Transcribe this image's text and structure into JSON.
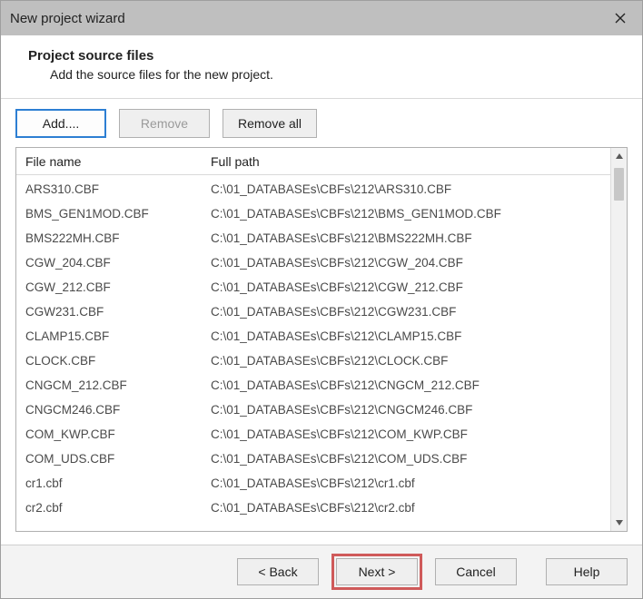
{
  "titlebar": {
    "title": "New project wizard"
  },
  "header": {
    "title": "Project source files",
    "subtitle": "Add the source files for the new project."
  },
  "toolbar": {
    "add_label": "Add....",
    "remove_label": "Remove",
    "remove_all_label": "Remove all"
  },
  "columns": {
    "name": "File name",
    "path": "Full path"
  },
  "rows": [
    {
      "name": "ARS310.CBF",
      "path": "C:\\01_DATABASEs\\CBFs\\212\\ARS310.CBF"
    },
    {
      "name": "BMS_GEN1MOD.CBF",
      "path": "C:\\01_DATABASEs\\CBFs\\212\\BMS_GEN1MOD.CBF"
    },
    {
      "name": "BMS222MH.CBF",
      "path": "C:\\01_DATABASEs\\CBFs\\212\\BMS222MH.CBF"
    },
    {
      "name": "CGW_204.CBF",
      "path": "C:\\01_DATABASEs\\CBFs\\212\\CGW_204.CBF"
    },
    {
      "name": "CGW_212.CBF",
      "path": "C:\\01_DATABASEs\\CBFs\\212\\CGW_212.CBF"
    },
    {
      "name": "CGW231.CBF",
      "path": "C:\\01_DATABASEs\\CBFs\\212\\CGW231.CBF"
    },
    {
      "name": "CLAMP15.CBF",
      "path": "C:\\01_DATABASEs\\CBFs\\212\\CLAMP15.CBF"
    },
    {
      "name": "CLOCK.CBF",
      "path": "C:\\01_DATABASEs\\CBFs\\212\\CLOCK.CBF"
    },
    {
      "name": "CNGCM_212.CBF",
      "path": "C:\\01_DATABASEs\\CBFs\\212\\CNGCM_212.CBF"
    },
    {
      "name": "CNGCM246.CBF",
      "path": "C:\\01_DATABASEs\\CBFs\\212\\CNGCM246.CBF"
    },
    {
      "name": "COM_KWP.CBF",
      "path": "C:\\01_DATABASEs\\CBFs\\212\\COM_KWP.CBF"
    },
    {
      "name": "COM_UDS.CBF",
      "path": "C:\\01_DATABASEs\\CBFs\\212\\COM_UDS.CBF"
    },
    {
      "name": "cr1.cbf",
      "path": "C:\\01_DATABASEs\\CBFs\\212\\cr1.cbf"
    },
    {
      "name": "cr2.cbf",
      "path": "C:\\01_DATABASEs\\CBFs\\212\\cr2.cbf"
    }
  ],
  "footer": {
    "back_label": "< Back",
    "next_label": "Next >",
    "cancel_label": "Cancel",
    "help_label": "Help"
  }
}
